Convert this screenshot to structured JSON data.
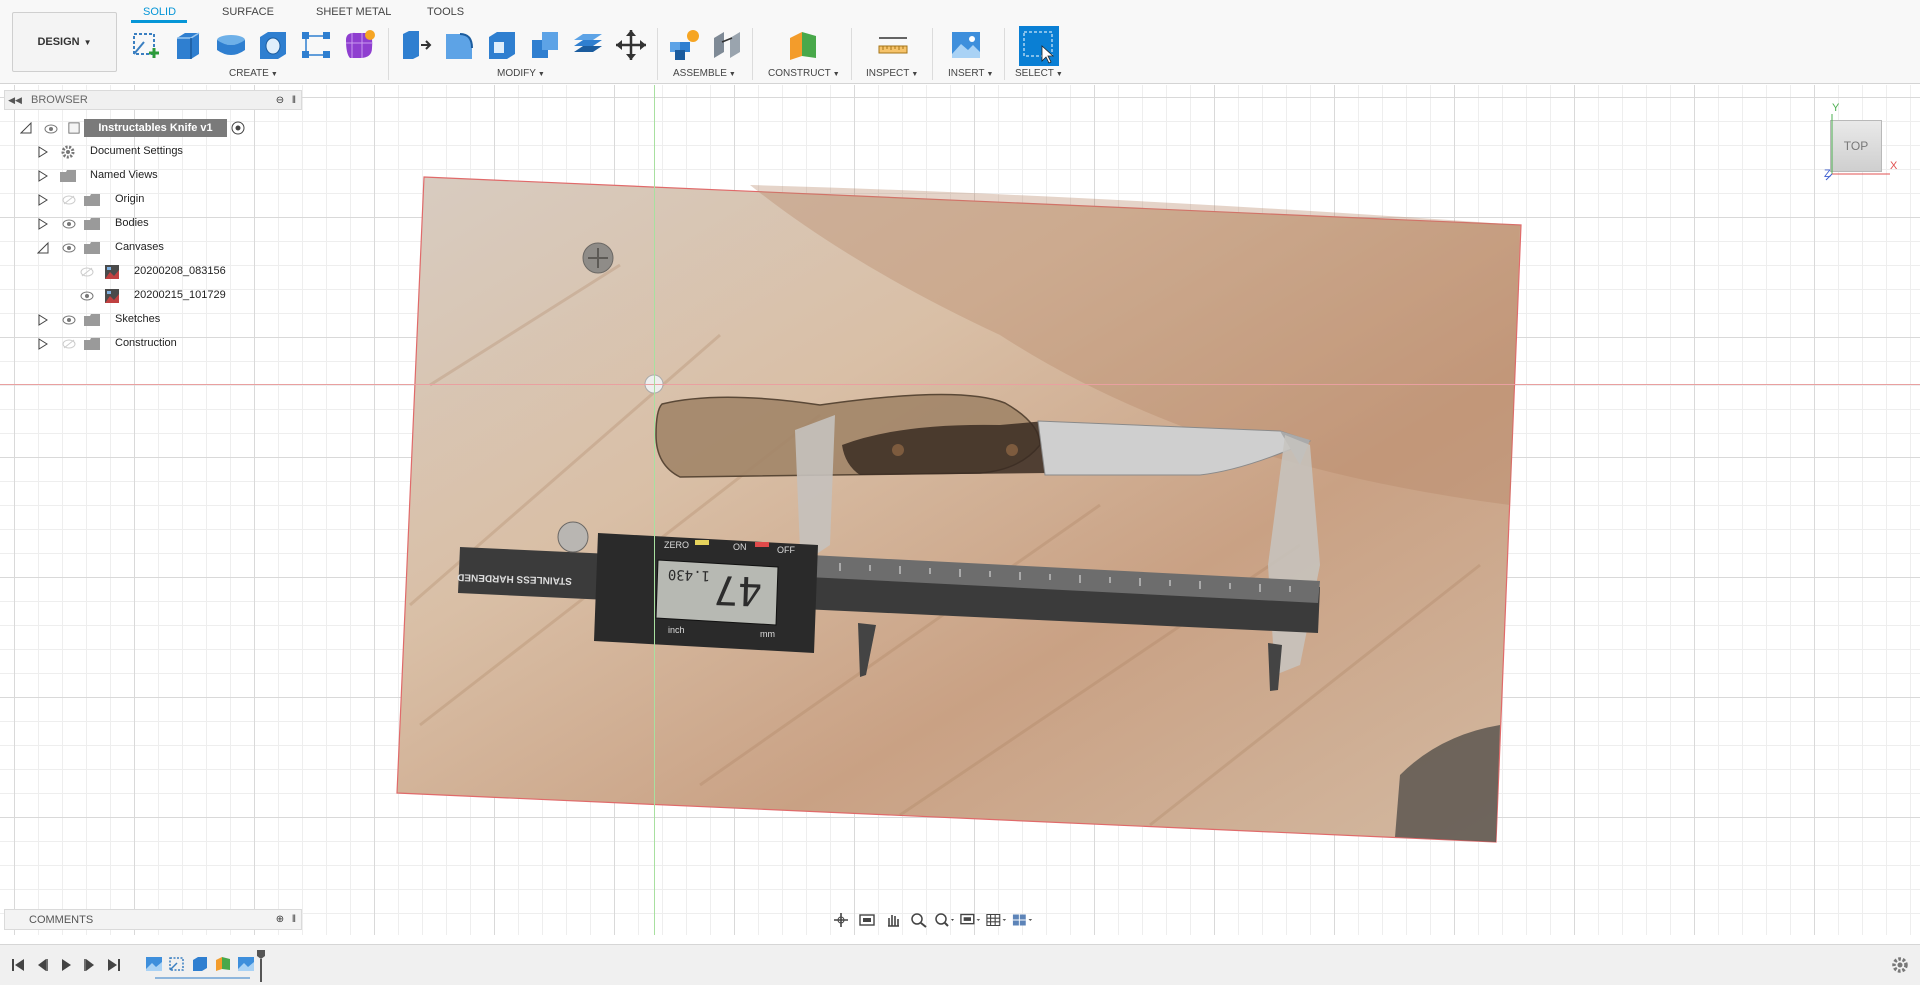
{
  "workspace": {
    "label": "DESIGN"
  },
  "tabs": [
    {
      "label": "SOLID",
      "active": true
    },
    {
      "label": "SURFACE",
      "active": false
    },
    {
      "label": "SHEET METAL",
      "active": false
    },
    {
      "label": "TOOLS",
      "active": false
    }
  ],
  "toolbar_groups": {
    "create": "CREATE",
    "modify": "MODIFY",
    "assemble": "ASSEMBLE",
    "construct": "CONSTRUCT",
    "inspect": "INSPECT",
    "insert": "INSERT",
    "select": "SELECT"
  },
  "browser": {
    "title": "BROWSER",
    "root": "Instructables Knife v1",
    "items": [
      {
        "label": "Document Settings",
        "icon": "gear-icon"
      },
      {
        "label": "Named Views",
        "icon": "folder-icon"
      },
      {
        "label": "Origin",
        "icon": "folder-icon",
        "visible": false
      },
      {
        "label": "Bodies",
        "icon": "folder-icon",
        "visible": true
      },
      {
        "label": "Canvases",
        "icon": "folder-icon",
        "visible": true,
        "expanded": true
      },
      {
        "label": "20200208_083156",
        "icon": "canvas-icon",
        "visible": false
      },
      {
        "label": "20200215_101729",
        "icon": "canvas-icon",
        "visible": true
      },
      {
        "label": "Sketches",
        "icon": "folder-icon",
        "visible": true
      },
      {
        "label": "Construction",
        "icon": "folder-icon",
        "visible": false
      }
    ]
  },
  "comments": {
    "title": "COMMENTS"
  },
  "viewcube": {
    "face": "TOP",
    "x": "X",
    "y": "Y",
    "z": "Z"
  },
  "canvas_photo": {
    "caliper_reading": "47",
    "caliper_small": "1.430",
    "brand_text": "STAINLESS HARDENED",
    "btn_zero": "ZERO",
    "btn_on": "ON",
    "btn_off": "OFF",
    "unit_mm": "mm",
    "unit_inch": "inch"
  },
  "colors": {
    "accent": "#0696d7",
    "select": "#0a7fd4"
  }
}
